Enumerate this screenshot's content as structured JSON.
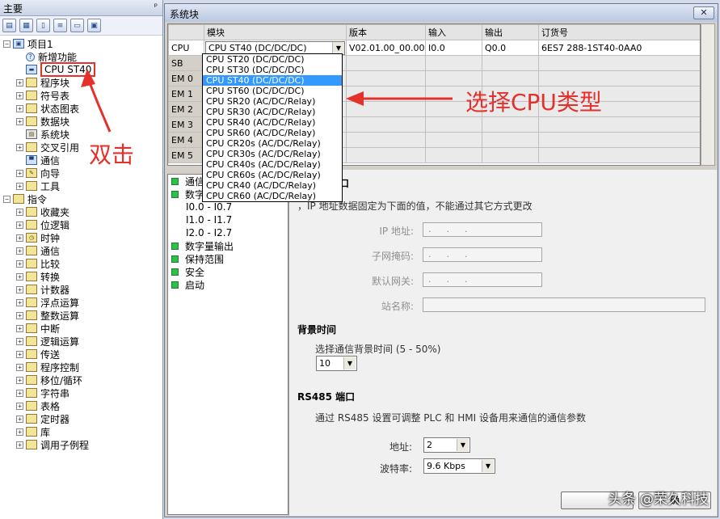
{
  "left_panel": {
    "title": "主要",
    "pin": "ᵖ",
    "toolbar_icons": [
      "view-icon",
      "grid-icon",
      "page-icon",
      "doc-icon",
      "form-icon",
      "monitor-icon"
    ],
    "tree": [
      {
        "label": "项目1",
        "expander": "−",
        "icon": "project-icon"
      },
      {
        "label": "新增功能",
        "expander": "",
        "icon": "help-icon"
      },
      {
        "label": "CPU ST40",
        "expander": "",
        "icon": "cpu-icon",
        "highlight": true
      },
      {
        "label": "程序块",
        "expander": "+",
        "icon": "folder-icon"
      },
      {
        "label": "符号表",
        "expander": "+",
        "icon": "folder-icon"
      },
      {
        "label": "状态图表",
        "expander": "+",
        "icon": "folder-icon"
      },
      {
        "label": "数据块",
        "expander": "+",
        "icon": "folder-icon"
      },
      {
        "label": "系统块",
        "expander": "",
        "icon": "system-block-icon"
      },
      {
        "label": "交叉引用",
        "expander": "+",
        "icon": "folder-icon"
      },
      {
        "label": "通信",
        "expander": "",
        "icon": "communication-icon"
      },
      {
        "label": "向导",
        "expander": "+",
        "icon": "wizard-icon"
      },
      {
        "label": "工具",
        "expander": "+",
        "icon": "folder-icon"
      },
      {
        "label": "指令",
        "expander": "−",
        "icon": "folder-icon"
      },
      {
        "label": "收藏夹",
        "expander": "+",
        "icon": "folder-icon"
      },
      {
        "label": "位逻辑",
        "expander": "+",
        "icon": "folder-icon"
      },
      {
        "label": "时钟",
        "expander": "+",
        "icon": "clock-icon"
      },
      {
        "label": "通信",
        "expander": "+",
        "icon": "folder-icon"
      },
      {
        "label": "比较",
        "expander": "+",
        "icon": "folder-icon"
      },
      {
        "label": "转换",
        "expander": "+",
        "icon": "folder-icon"
      },
      {
        "label": "计数器",
        "expander": "+",
        "icon": "folder-icon"
      },
      {
        "label": "浮点运算",
        "expander": "+",
        "icon": "folder-icon"
      },
      {
        "label": "整数运算",
        "expander": "+",
        "icon": "folder-icon"
      },
      {
        "label": "中断",
        "expander": "+",
        "icon": "folder-icon"
      },
      {
        "label": "逻辑运算",
        "expander": "+",
        "icon": "folder-icon"
      },
      {
        "label": "传送",
        "expander": "+",
        "icon": "folder-icon"
      },
      {
        "label": "程序控制",
        "expander": "+",
        "icon": "folder-icon"
      },
      {
        "label": "移位/循环",
        "expander": "+",
        "icon": "folder-icon"
      },
      {
        "label": "字符串",
        "expander": "+",
        "icon": "folder-icon"
      },
      {
        "label": "表格",
        "expander": "+",
        "icon": "folder-icon"
      },
      {
        "label": "定时器",
        "expander": "+",
        "icon": "folder-icon"
      },
      {
        "label": "库",
        "expander": "+",
        "icon": "folder-icon"
      },
      {
        "label": "调用子例程",
        "expander": "+",
        "icon": "folder-icon"
      }
    ]
  },
  "dialog": {
    "title": "系统块",
    "close": "✕",
    "columns": [
      "",
      "模块",
      "版本",
      "输入",
      "输出",
      "订货号"
    ],
    "rows": [
      {
        "slot": "CPU",
        "module": "CPU ST40 (DC/DC/DC)",
        "version": "V02.01.00_00.00...",
        "input": "I0.0",
        "output": "Q0.0",
        "order": "6ES7 288-1ST40-0AA0"
      },
      {
        "slot": "SB",
        "module": "",
        "version": "",
        "input": "",
        "output": "",
        "order": ""
      },
      {
        "slot": "EM 0",
        "module": "",
        "version": "",
        "input": "",
        "output": "",
        "order": ""
      },
      {
        "slot": "EM 1",
        "module": "",
        "version": "",
        "input": "",
        "output": "",
        "order": ""
      },
      {
        "slot": "EM 2",
        "module": "",
        "version": "",
        "input": "",
        "output": "",
        "order": ""
      },
      {
        "slot": "EM 3",
        "module": "",
        "version": "",
        "input": "",
        "output": "",
        "order": ""
      },
      {
        "slot": "EM 4",
        "module": "",
        "version": "",
        "input": "",
        "output": "",
        "order": ""
      },
      {
        "slot": "EM 5",
        "module": "",
        "version": "",
        "input": "",
        "output": "",
        "order": ""
      }
    ],
    "module_dropdown": {
      "selected": "CPU ST40 (DC/DC/DC)",
      "options": [
        "CPU ST20 (DC/DC/DC)",
        "CPU ST30 (DC/DC/DC)",
        "CPU ST40 (DC/DC/DC)",
        "CPU ST60 (DC/DC/DC)",
        "CPU SR20 (AC/DC/Relay)",
        "CPU SR30 (AC/DC/Relay)",
        "CPU SR40 (AC/DC/Relay)",
        "CPU SR60 (AC/DC/Relay)",
        "CPU CR20s (AC/DC/Relay)",
        "CPU CR30s (AC/DC/Relay)",
        "CPU CR40s (AC/DC/Relay)",
        "CPU CR60s (AC/DC/Relay)",
        "CPU CR40 (AC/DC/Relay)",
        "CPU CR60 (AC/DC/Relay)"
      ]
    },
    "nav": [
      {
        "label": "通信",
        "sub": false
      },
      {
        "label": "数字",
        "sub": false
      },
      {
        "label": "I0.0 - I0.7",
        "sub": true
      },
      {
        "label": "I1.0 - I1.7",
        "sub": true
      },
      {
        "label": "I2.0 - I2.7",
        "sub": true
      },
      {
        "label": "数字量输出",
        "sub": false
      },
      {
        "label": "保持范围",
        "sub": false
      },
      {
        "label": "安全",
        "sub": false
      },
      {
        "label": "启动",
        "sub": false
      }
    ],
    "pane": {
      "section_partial": "口",
      "ip_note": "，IP 地址数据固定为下面的值，不能通过其它方式更改",
      "ip_label": "IP 地址:",
      "subnet_label": "子网掩码:",
      "gateway_label": "默认网关:",
      "station_label": "站名称:",
      "ip_dots": "...",
      "bg_title": "背景时间",
      "bg_label": "选择通信背景时间 (5 - 50%)",
      "bg_value": "10",
      "rs485_title": "RS485 端口",
      "rs485_note": "通过 RS485 设置可调整 PLC 和 HMI 设备用来通信的通信参数",
      "addr_label": "地址:",
      "addr_value": "2",
      "baud_label": "波特率:",
      "baud_value": "9.6 Kbps",
      "button_partial": "确"
    }
  },
  "annotations": {
    "select_cpu": "选择CPU类型",
    "double_click": "双击",
    "watermark": "头条 @荣久科技",
    "color": "#e4312b"
  }
}
